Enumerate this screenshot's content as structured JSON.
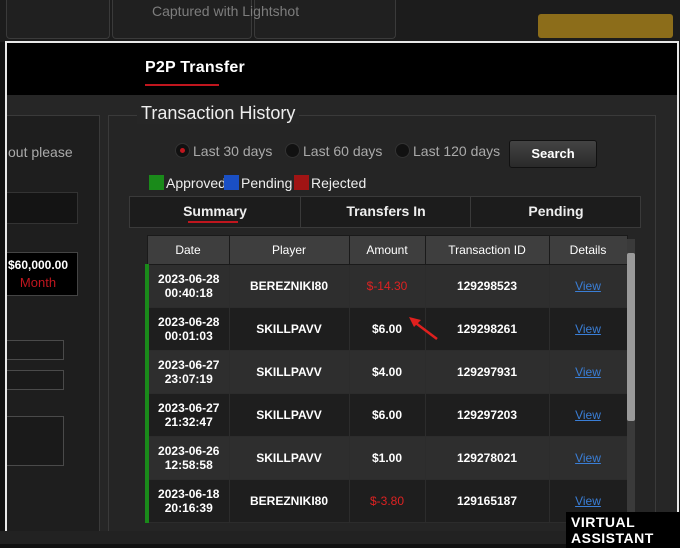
{
  "capture_label": "Captured with Lightshot",
  "nav": {
    "active_tab": "P2P Transfer"
  },
  "left_panel": {
    "text": "out please",
    "amount": "$60,000.00",
    "period": "Month"
  },
  "history": {
    "title": "Transaction History",
    "filters": [
      {
        "label": "Last 30 days",
        "selected": true
      },
      {
        "label": "Last 60 days",
        "selected": false
      },
      {
        "label": "Last 120 days",
        "selected": false
      }
    ],
    "search_label": "Search",
    "legend": [
      {
        "label": "Approved",
        "color": "#1a8a1a"
      },
      {
        "label": "Pending",
        "color": "#1a4fc4"
      },
      {
        "label": "Rejected",
        "color": "#a01414"
      }
    ],
    "tabs": [
      "Summary",
      "Transfers In",
      "Pending"
    ],
    "columns": [
      "Date",
      "Player",
      "Amount",
      "Transaction ID",
      "Details"
    ],
    "rows": [
      {
        "date": "2023-06-28",
        "time": "00:40:18",
        "player": "BEREZNIKI80",
        "amount": "$-14.30",
        "id": "129298523",
        "details": "View",
        "negative": true
      },
      {
        "date": "2023-06-28",
        "time": "00:01:03",
        "player": "SKILLPAVV",
        "amount": "$6.00",
        "id": "129298261",
        "details": "View",
        "negative": false
      },
      {
        "date": "2023-06-27",
        "time": "23:07:19",
        "player": "SKILLPAVV",
        "amount": "$4.00",
        "id": "129297931",
        "details": "View",
        "negative": false
      },
      {
        "date": "2023-06-27",
        "time": "21:32:47",
        "player": "SKILLPAVV",
        "amount": "$6.00",
        "id": "129297203",
        "details": "View",
        "negative": false
      },
      {
        "date": "2023-06-26",
        "time": "12:58:58",
        "player": "SKILLPAVV",
        "amount": "$1.00",
        "id": "129278021",
        "details": "View",
        "negative": false
      },
      {
        "date": "2023-06-18",
        "time": "20:16:39",
        "player": "BEREZNIKI80",
        "amount": "$-3.80",
        "id": "129165187",
        "details": "View",
        "negative": true
      }
    ]
  },
  "assistant_label": "VIRTUAL ASSISTANT"
}
